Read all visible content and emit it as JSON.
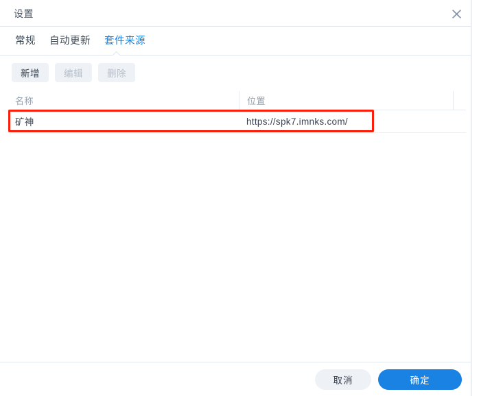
{
  "window": {
    "title": "设置",
    "close_icon": "close-icon"
  },
  "tabs": [
    {
      "label": "常规",
      "active": false
    },
    {
      "label": "自动更新",
      "active": false
    },
    {
      "label": "套件来源",
      "active": true
    }
  ],
  "toolbar": {
    "add_label": "新增",
    "edit_label": "编辑",
    "delete_label": "删除"
  },
  "table": {
    "headers": [
      "名称",
      "位置",
      ""
    ],
    "rows": [
      {
        "name": "矿神",
        "location": "https://spk7.imnks.com/"
      }
    ]
  },
  "footer": {
    "cancel_label": "取消",
    "ok_label": "确定"
  },
  "colors": {
    "accent": "#1a82e2",
    "annotation": "#fb1e0a",
    "button_bg": "#eef1f6",
    "divider": "#e3e8ee",
    "text": "#39424f",
    "muted_text": "#97a1ae",
    "disabled_text": "#b6bfcb"
  }
}
